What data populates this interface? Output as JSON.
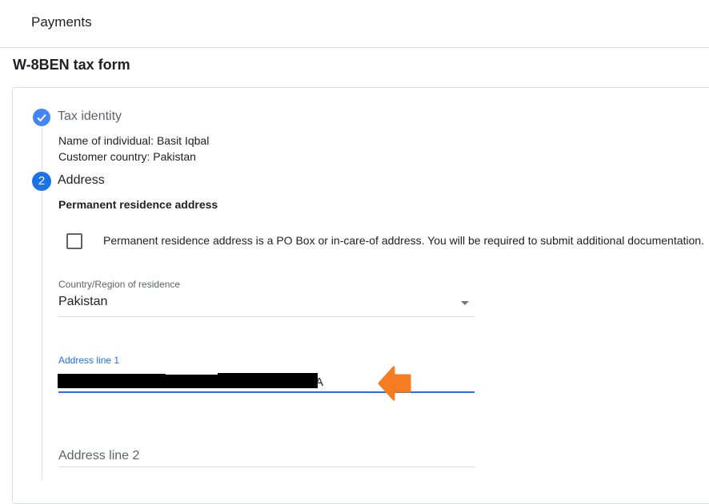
{
  "topbar": {
    "title": "Payments"
  },
  "page": {
    "title": "W-8BEN tax form"
  },
  "steps": {
    "step1": {
      "title": "Tax identity",
      "lines": [
        "Name of individual: Basit Iqbal",
        "Customer country: Pakistan"
      ],
      "status_icon": "check-icon"
    },
    "step2": {
      "number": "2",
      "title": "Address",
      "section_title": "Permanent residence address",
      "po_box_checkbox": {
        "label": "Permanent residence address is a PO Box or in-care-of address. You will be required to submit additional documentation.",
        "checked": false
      },
      "country_field": {
        "label": "Country/Region of residence",
        "value": "Pakistan"
      },
      "address_line1": {
        "label": "Address line 1",
        "value": "A",
        "redacted": true
      },
      "address_line2": {
        "placeholder": "Address line 2"
      }
    }
  },
  "colors": {
    "accent": "#1a73e8",
    "check": "#4285f4",
    "arrow": "#f57c20"
  }
}
